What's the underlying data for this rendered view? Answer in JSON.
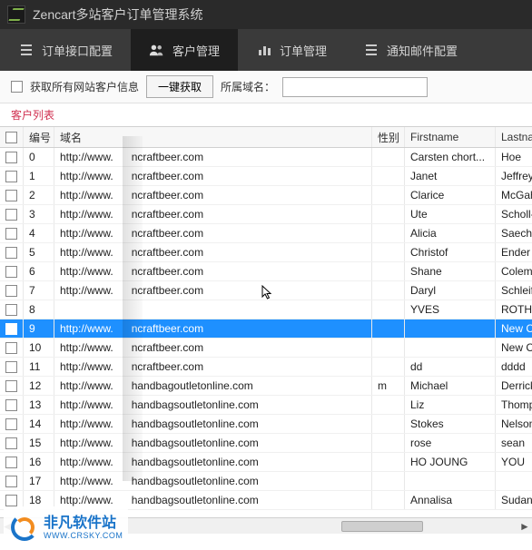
{
  "app": {
    "title": "Zencart多站客户订单管理系统"
  },
  "tabs": [
    {
      "label": "订单接口配置",
      "icon": "list-icon"
    },
    {
      "label": "客户管理",
      "icon": "users-icon",
      "active": true
    },
    {
      "label": "订单管理",
      "icon": "bars-icon"
    },
    {
      "label": "通知邮件配置",
      "icon": "list-icon"
    }
  ],
  "toolbar": {
    "fetch_all_label": "获取所有网站客户信息",
    "fetch_btn": "一键获取",
    "domain_label": "所属域名：",
    "domain_value": ""
  },
  "subheader": "客户列表",
  "columns": {
    "chk": "",
    "id": "编号",
    "domain": "域名",
    "gender": "性别",
    "fname": "Firstname",
    "lname": "Lastname"
  },
  "rows": [
    {
      "id": "0",
      "domain_pre": "http://www.",
      "domain_suf": "ncraftbeer.com",
      "gender": "",
      "fname": "Carsten chort...",
      "lname": "Hoe"
    },
    {
      "id": "1",
      "domain_pre": "http://www.",
      "domain_suf": "ncraftbeer.com",
      "gender": "",
      "fname": "Janet",
      "lname": "Jeffrey"
    },
    {
      "id": "2",
      "domain_pre": "http://www.",
      "domain_suf": "ncraftbeer.com",
      "gender": "",
      "fname": "Clarice",
      "lname": "McGahey"
    },
    {
      "id": "3",
      "domain_pre": "http://www.",
      "domain_suf": "ncraftbeer.com",
      "gender": "",
      "fname": "Ute",
      "lname": "Scholl-Ha"
    },
    {
      "id": "4",
      "domain_pre": "http://www.",
      "domain_suf": "ncraftbeer.com",
      "gender": "",
      "fname": "Alicia",
      "lname": "Saechao"
    },
    {
      "id": "5",
      "domain_pre": "http://www.",
      "domain_suf": "ncraftbeer.com",
      "gender": "",
      "fname": "Christof",
      "lname": "Ender"
    },
    {
      "id": "6",
      "domain_pre": "http://www.",
      "domain_suf": "ncraftbeer.com",
      "gender": "",
      "fname": "Shane",
      "lname": "Coleman"
    },
    {
      "id": "7",
      "domain_pre": "http://www.",
      "domain_suf": "ncraftbeer.com",
      "gender": "",
      "fname": "Daryl",
      "lname": "Schleif"
    },
    {
      "id": "8",
      "domain_pre": "",
      "domain_suf": "",
      "gender": "",
      "fname": "YVES",
      "lname": "ROTH"
    },
    {
      "id": "9",
      "domain_pre": "http://www.",
      "domain_suf": "ncraftbeer.com",
      "gender": "",
      "fname": "",
      "lname": "New Cust",
      "selected": true
    },
    {
      "id": "10",
      "domain_pre": "http://www.",
      "domain_suf": "ncraftbeer.com",
      "gender": "",
      "fname": "",
      "lname": "New Cust"
    },
    {
      "id": "11",
      "domain_pre": "http://www.",
      "domain_suf": "ncraftbeer.com",
      "gender": "",
      "fname": "dd",
      "lname": "dddd"
    },
    {
      "id": "12",
      "domain_pre": "http://www.",
      "domain_suf": "handbagoutletonline.com",
      "gender": "m",
      "fname": "Michael",
      "lname": "Derricks"
    },
    {
      "id": "13",
      "domain_pre": "http://www.",
      "domain_suf": "handbagsoutletonline.com",
      "gender": "",
      "fname": "Liz",
      "lname": "Thompso"
    },
    {
      "id": "14",
      "domain_pre": "http://www.",
      "domain_suf": "handbagsoutletonline.com",
      "gender": "",
      "fname": "Stokes",
      "lname": "Nelson"
    },
    {
      "id": "15",
      "domain_pre": "http://www.",
      "domain_suf": "handbagsoutletonline.com",
      "gender": "",
      "fname": "rose",
      "lname": "sean"
    },
    {
      "id": "16",
      "domain_pre": "http://www.",
      "domain_suf": "handbagsoutletonline.com",
      "gender": "",
      "fname": "HO JOUNG",
      "lname": "YOU"
    },
    {
      "id": "17",
      "domain_pre": "http://www.",
      "domain_suf": "handbagsoutletonline.com",
      "gender": "",
      "fname": "",
      "lname": ""
    },
    {
      "id": "18",
      "domain_pre": "http://www.",
      "domain_suf": "handbagsoutletonline.com",
      "gender": "",
      "fname": "Annalisa",
      "lname": "Sudano"
    }
  ],
  "watermark": {
    "cn": "非凡软件站",
    "en": "WWW.CRSKY.COM"
  }
}
